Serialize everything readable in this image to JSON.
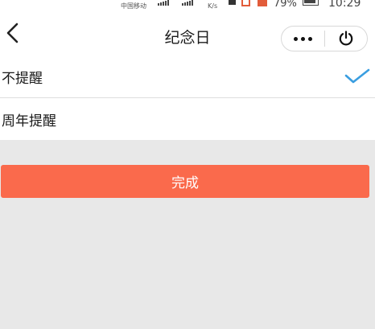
{
  "status_bar": {
    "carrier": "中国移动",
    "net_speed": "K/s",
    "battery": "79%",
    "time": "10:29"
  },
  "nav": {
    "title": "纪念日",
    "back_icon": "chevron-left-icon",
    "more_icon": "more-dots-icon",
    "power_icon": "power-icon"
  },
  "options": [
    {
      "label": "不提醒",
      "selected": true
    },
    {
      "label": "周年提醒",
      "selected": false
    }
  ],
  "done_button": {
    "label": "完成"
  },
  "colors": {
    "accent": "#fa6a4c",
    "check": "#3a9ee0",
    "background": "#e8e8e8"
  }
}
